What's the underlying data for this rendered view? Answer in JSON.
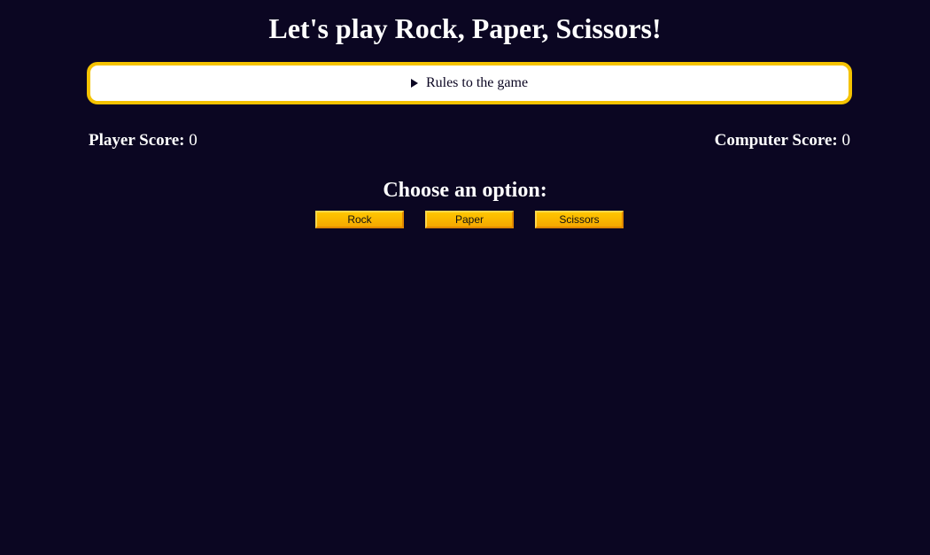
{
  "header": {
    "title": "Let's play Rock, Paper, Scissors!"
  },
  "rules": {
    "summary": "Rules to the game",
    "icon": "disclosure-triangle-right"
  },
  "scores": {
    "player_label": "Player Score:",
    "player_value": "0",
    "computer_label": "Computer Score:",
    "computer_value": "0"
  },
  "choose": {
    "prompt": "Choose an option:",
    "options": [
      "Rock",
      "Paper",
      "Scissors"
    ]
  },
  "colors": {
    "background": "#0b0622",
    "accent": "#f5c300",
    "button": "#ffc600"
  }
}
